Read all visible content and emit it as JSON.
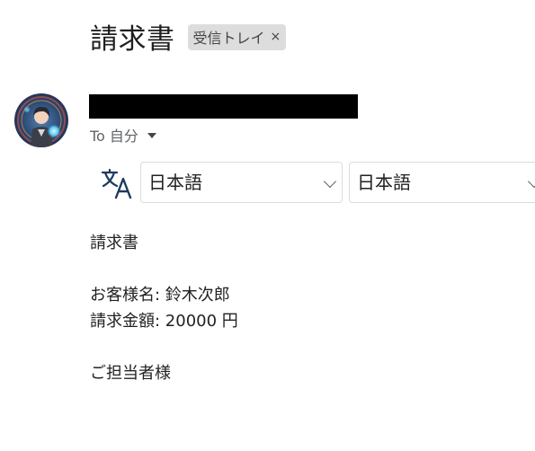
{
  "subject": "請求書",
  "label_chip": {
    "label": "受信トレイ",
    "remove": "×"
  },
  "sender": {
    "avatar": "avatar-image"
  },
  "recipient": {
    "to_text": "To 自分"
  },
  "translate": {
    "icon": "translate-icon",
    "source_language": "日本語",
    "target_language": "日本語"
  },
  "body": {
    "line1": "請求書",
    "line2": "お客様名: 鈴木次郎",
    "line3": "請求金額: 20000 円",
    "line4": "ご担当者様"
  }
}
